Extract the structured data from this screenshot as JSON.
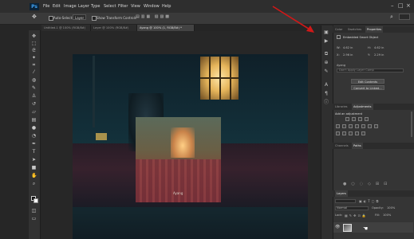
{
  "app": {
    "logo": "Ps"
  },
  "menu": [
    "File",
    "Edit",
    "Image",
    "Layer",
    "Type",
    "Select",
    "Filter",
    "View",
    "Window",
    "Help"
  ],
  "options_bar": {
    "auto_select_label": "Auto-Select:",
    "auto_select_value": "Layer",
    "transform_controls_label": "Show Transform Controls"
  },
  "tabs": [
    {
      "label": "Untitled-1 @ 100% (RGB/8#)",
      "active": false
    },
    {
      "label": "Layer @ 100% (RGB/8#)",
      "active": false
    },
    {
      "label": "Ayang @ 100% (1, RGB/8#) *",
      "active": true
    }
  ],
  "canvas": {
    "inset_caption": "Ayang"
  },
  "properties_panel": {
    "tabs": [
      "Color",
      "Swatches",
      "Properties"
    ],
    "active_tab": "Properties",
    "title": "Embedded Smart Object",
    "w_label": "W:",
    "w_value": "4.62 in",
    "h_label": "H:",
    "h_value": "4.62 in",
    "x_label": "X:",
    "x_value": "2.96 in",
    "y_label": "Y:",
    "y_value": "2.29 in",
    "comp_label": "Ayang",
    "comp_placeholder": "Don't Apply Layer Comp",
    "edit_contents_label": "Edit Contents",
    "convert_label": "Convert to Linked..."
  },
  "adjustments_panel": {
    "tabs": [
      "Libraries",
      "Adjustments"
    ],
    "active_tab": "Adjustments",
    "heading": "Add an adjustment"
  },
  "channels_panel": {
    "tabs": [
      "Channels",
      "Paths"
    ],
    "active_tab": "Paths"
  },
  "layers_panel": {
    "tab": "Layers",
    "blend_mode": "Normal",
    "opacity_label": "Opacity:",
    "opacity_value": "100%",
    "lock_label": "Lock:",
    "fill_label": "Fill:",
    "fill_value": "100%"
  },
  "colors": {
    "accent": "#3ea1f2",
    "annotation": "#d01818"
  },
  "icons": [
    "move-tool-icon",
    "marquee-tool-icon",
    "lasso-tool-icon",
    "magic-wand-icon",
    "crop-tool-icon",
    "eyedropper-icon",
    "healing-brush-icon",
    "brush-tool-icon",
    "clone-stamp-icon",
    "history-brush-icon",
    "eraser-icon",
    "gradient-icon",
    "blur-icon",
    "dodge-icon",
    "pen-tool-icon",
    "type-tool-icon",
    "path-select-icon",
    "shape-tool-icon",
    "hand-tool-icon",
    "zoom-tool-icon"
  ]
}
